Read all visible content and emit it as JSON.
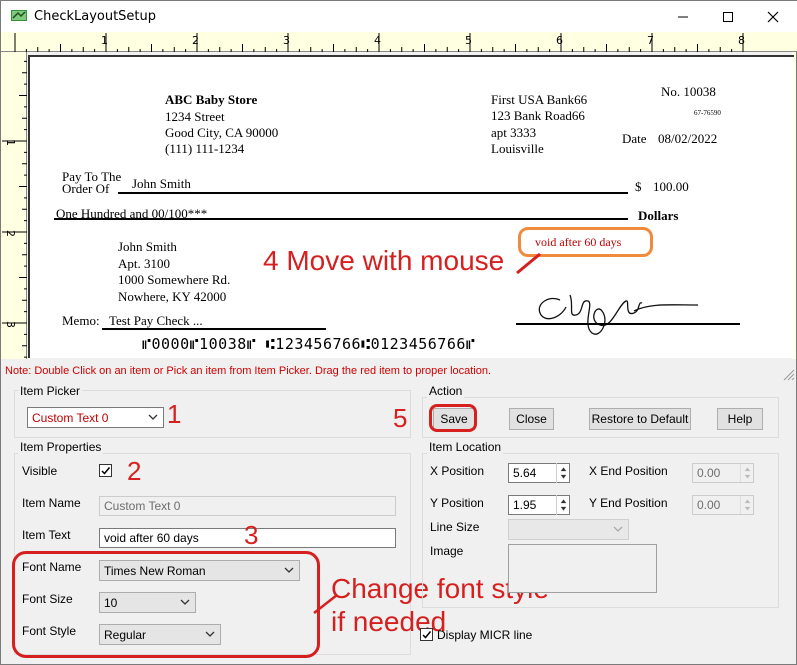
{
  "window": {
    "title": "CheckLayoutSetup"
  },
  "ruler": {
    "h_numbers": [
      "1",
      "2",
      "3",
      "4",
      "5",
      "6",
      "7",
      "8"
    ],
    "v_numbers": [
      "1",
      "2",
      "3"
    ]
  },
  "check": {
    "payer": {
      "name": "ABC Baby Store",
      "line1": "1234 Street",
      "line2": "Good City, CA 90000",
      "phone": "(111) 111-1234"
    },
    "bank": {
      "name": "First USA Bank66",
      "line1": "123 Bank Road66",
      "line2": "apt 3333",
      "city": "Louisville"
    },
    "check_no": "No. 10038",
    "routing_fraction": "67-76590",
    "date_label": "Date",
    "date_value": "08/02/2022",
    "pay_to_label_1": "Pay To The",
    "pay_to_label_2": "Order Of",
    "payee": "John Smith",
    "dollar_sign": "$",
    "amount": "100.00",
    "amount_words": "One Hundred  and 00/100***",
    "dollars_label": "Dollars",
    "address": {
      "name": "John Smith",
      "line1": "Apt. 3100",
      "line2": "1000 Somewhere Rd.",
      "line3": "Nowhere, KY 42000"
    },
    "void_text": "void after 60 days",
    "memo_label": "Memo:",
    "memo_value": "Test Pay Check ...",
    "micr": "⑈0000⑈10038⑈ ⑆123456766⑆0123456766⑈"
  },
  "note": "Note: Double Click on an item or Pick an item from Item Picker. Drag the red item to proper location.",
  "item_picker": {
    "group_label": "Item Picker",
    "selected": "Custom Text 0"
  },
  "action": {
    "group_label": "Action",
    "save": "Save",
    "close": "Close",
    "restore": "Restore to Default",
    "help": "Help"
  },
  "item_properties": {
    "group_label": "Item Properties",
    "visible_label": "Visible",
    "visible_checked": true,
    "item_name_label": "Item Name",
    "item_name_value": "Custom Text 0",
    "item_text_label": "Item Text",
    "item_text_value": "void after 60 days",
    "font_name_label": "Font Name",
    "font_name_value": "Times New Roman",
    "font_size_label": "Font Size",
    "font_size_value": "10",
    "font_style_label": "Font Style",
    "font_style_value": "Regular"
  },
  "item_location": {
    "group_label": "Item Location",
    "x_label": "X Position",
    "x_value": "5.64",
    "y_label": "Y Position",
    "y_value": "1.95",
    "x_end_label": "X End Position",
    "x_end_value": "0.00",
    "y_end_label": "Y End Position",
    "y_end_value": "0.00",
    "line_size_label": "Line Size",
    "image_label": "Image",
    "display_micr_label": "Display MICR line",
    "display_micr_checked": true
  },
  "annotations": {
    "n1": "1",
    "n2": "2",
    "n3": "3",
    "n5": "5",
    "move": "4 Move with mouse",
    "change_1": "Change font style",
    "change_2": "if needed"
  },
  "colors": {
    "annotation_red": "#d62020",
    "void_orange": "#f08a3c",
    "note_red": "#d00000"
  }
}
